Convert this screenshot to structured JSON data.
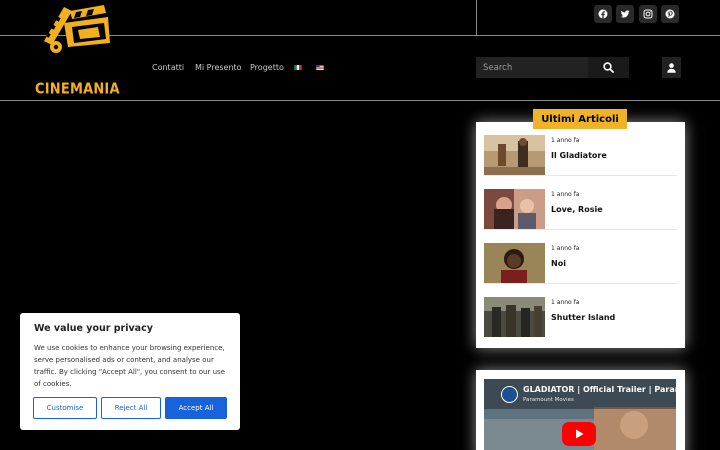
{
  "topbar": {
    "social_icons": [
      "facebook-icon",
      "twitter-icon",
      "instagram-icon",
      "pinterest-icon"
    ]
  },
  "header": {
    "logo_text": "CINEMANIA",
    "nav": [
      {
        "label": "Contatti"
      },
      {
        "label": "Mi Presento"
      },
      {
        "label": "Progetto"
      }
    ],
    "languages": [
      "italian-flag-icon",
      "english-flag-icon"
    ],
    "search": {
      "placeholder": "Search"
    }
  },
  "sidebar": {
    "widget_title": "Ultimi Articoli",
    "articles": [
      {
        "time": "1 anno fa",
        "title": "Il Gladiatore"
      },
      {
        "time": "1 anno fa",
        "title": "Love, Rosie"
      },
      {
        "time": "1 anno fa",
        "title": "Noi"
      },
      {
        "time": "1 anno fa",
        "title": "Shutter Island"
      }
    ],
    "video": {
      "title": "GLADIATOR | Official Trailer | Param",
      "channel": "Paramount Movies"
    }
  },
  "cookie": {
    "title": "We value your privacy",
    "text": "We use cookies to enhance your browsing experience, serve personalised ads or content, and analyse our traffic. By clicking \"Accept All\", you consent to our use of cookies.",
    "customise": "Customise",
    "reject": "Reject All",
    "accept": "Accept All"
  },
  "colors": {
    "accent": "#f0b229",
    "button_blue": "#1863dc",
    "youtube_red": "#ff0000"
  }
}
